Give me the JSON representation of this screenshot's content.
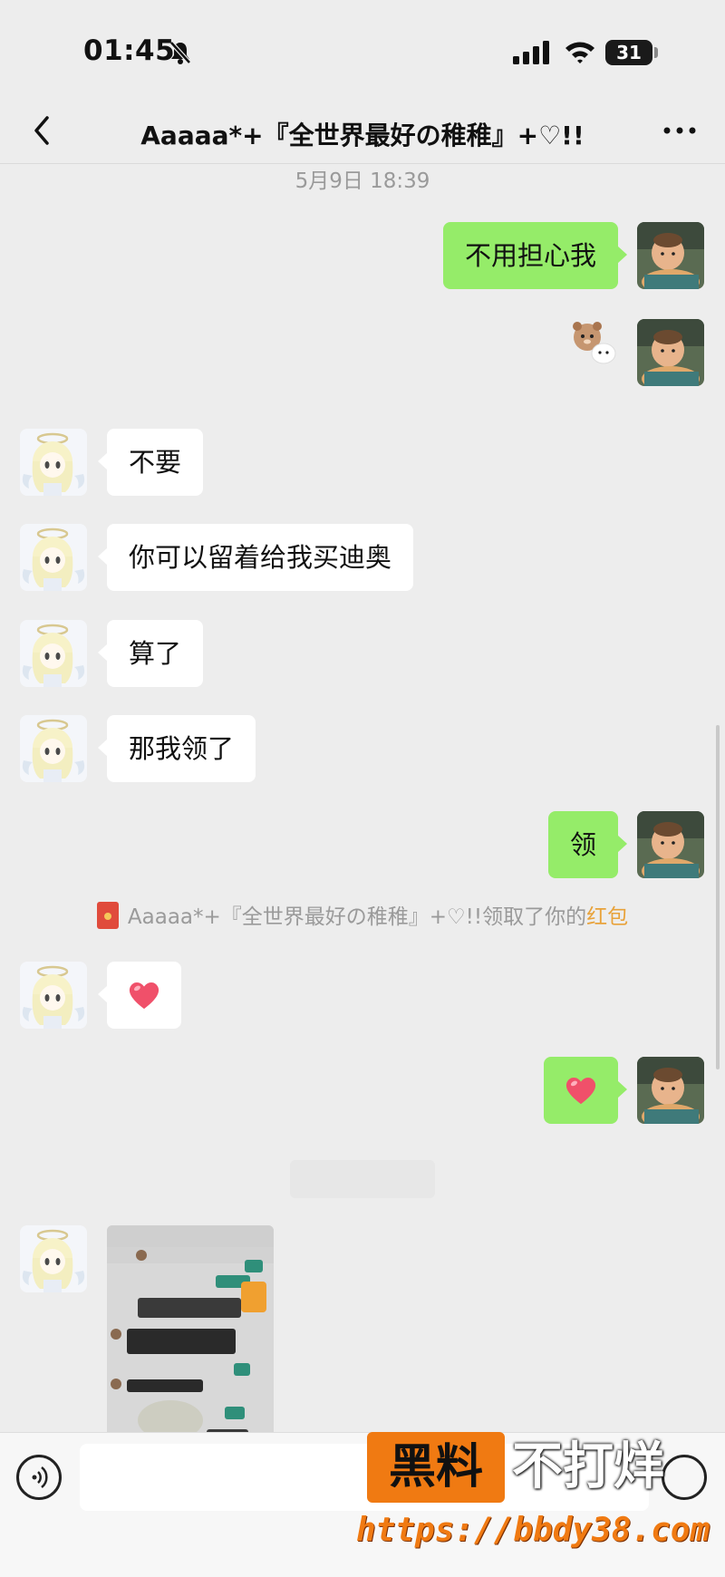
{
  "status_bar": {
    "time": "01:45",
    "battery": "31"
  },
  "header": {
    "title": "Aaaaa*+『全世界最好の稚稚』+♡!!"
  },
  "timestamp": "5月9日 18:39",
  "messages": [
    {
      "from": "me",
      "text": "不用担心我"
    },
    {
      "from": "me",
      "sticker": "bear-sticker"
    },
    {
      "from": "them",
      "text": "不要"
    },
    {
      "from": "them",
      "text": "你可以留着给我买迪奥"
    },
    {
      "from": "them",
      "text": "算了"
    },
    {
      "from": "them",
      "text": "那我领了"
    },
    {
      "from": "me",
      "text": "领"
    },
    {
      "from": "them",
      "sticker": "heart"
    },
    {
      "from": "me",
      "sticker": "heart"
    },
    {
      "from": "them",
      "image": "chat-screenshot"
    }
  ],
  "system_note": {
    "prefix": "Aaaaa*+『全世界最好の稚稚』+♡!!领取了你的",
    "link": "红包"
  },
  "watermark": {
    "box_text": "黑料",
    "text": "不打烊",
    "url": "https://bbdy38.com"
  },
  "colors": {
    "self_bubble": "#95ec69",
    "other_bubble": "#ffffff",
    "background": "#ededed",
    "redpacket_link": "#e8a23a"
  }
}
